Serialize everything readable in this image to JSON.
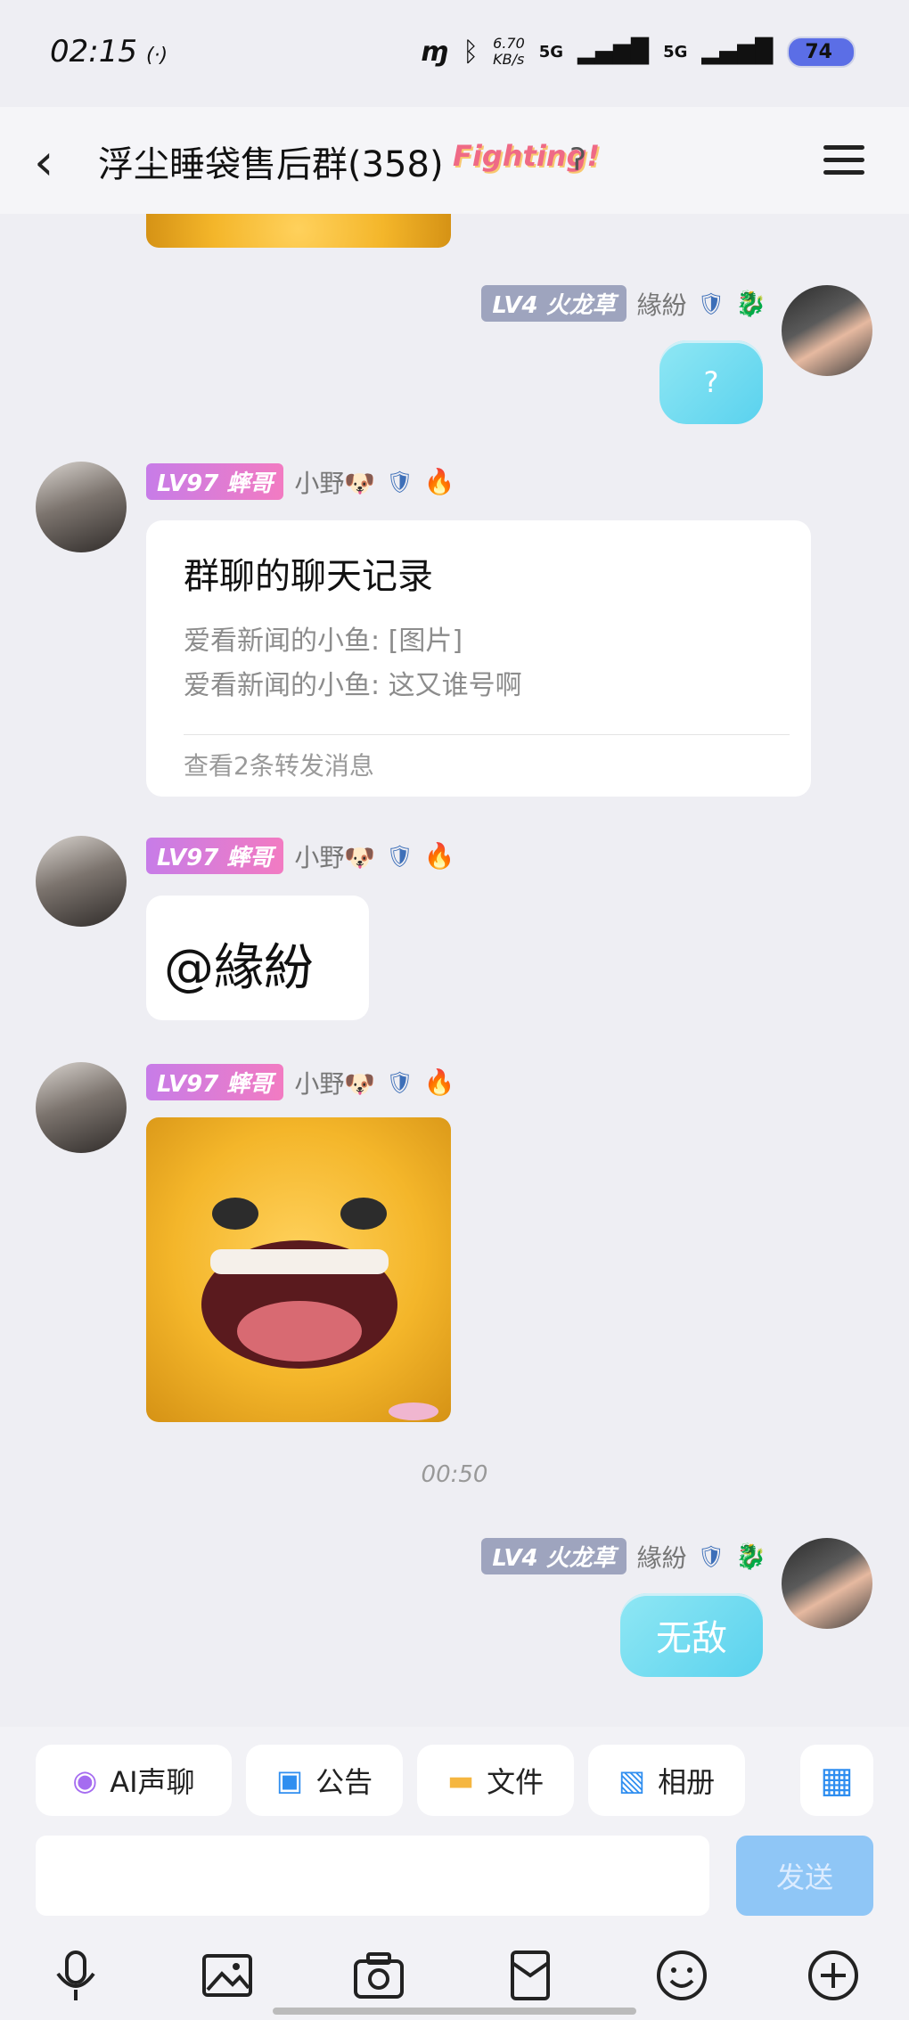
{
  "status": {
    "time": "02:15",
    "hotspot": "(·)",
    "net_speed": "6.70\nKB/s",
    "net1": "5G",
    "net2": "5G",
    "battery": "74"
  },
  "header": {
    "back": "‹",
    "title": "浮尘睡袋售后群(358)",
    "tag": "Fighting!"
  },
  "messages": {
    "me1": {
      "level": "LV4 火龙草",
      "name": "緣紛",
      "text": "?"
    },
    "m1": {
      "level": "LV97 蟀哥",
      "name": "小野🐶",
      "card_title": "群聊的聊天记录",
      "line1": "爱看新闻的小鱼: [图片]",
      "line2": "爱看新闻的小鱼: 这又谁号啊",
      "footer": "查看2条转发消息"
    },
    "m2": {
      "level": "LV97 蟀哥",
      "name": "小野🐶",
      "text": "@緣紛"
    },
    "m3": {
      "level": "LV97 蟀哥",
      "name": "小野🐶"
    },
    "time": "00:50",
    "me2": {
      "level": "LV4 火龙草",
      "name": "緣紛",
      "text": "无敌"
    }
  },
  "shortcuts": [
    {
      "label": "AI声聊",
      "icon": "ai-voice-icon",
      "color": "#a56cf0"
    },
    {
      "label": "公告",
      "icon": "announcement-icon",
      "color": "#2f8ef0"
    },
    {
      "label": "文件",
      "icon": "folder-icon",
      "color": "#f5b640"
    },
    {
      "label": "相册",
      "icon": "album-icon",
      "color": "#2f8ef0"
    }
  ],
  "input": {
    "send": "发送"
  }
}
